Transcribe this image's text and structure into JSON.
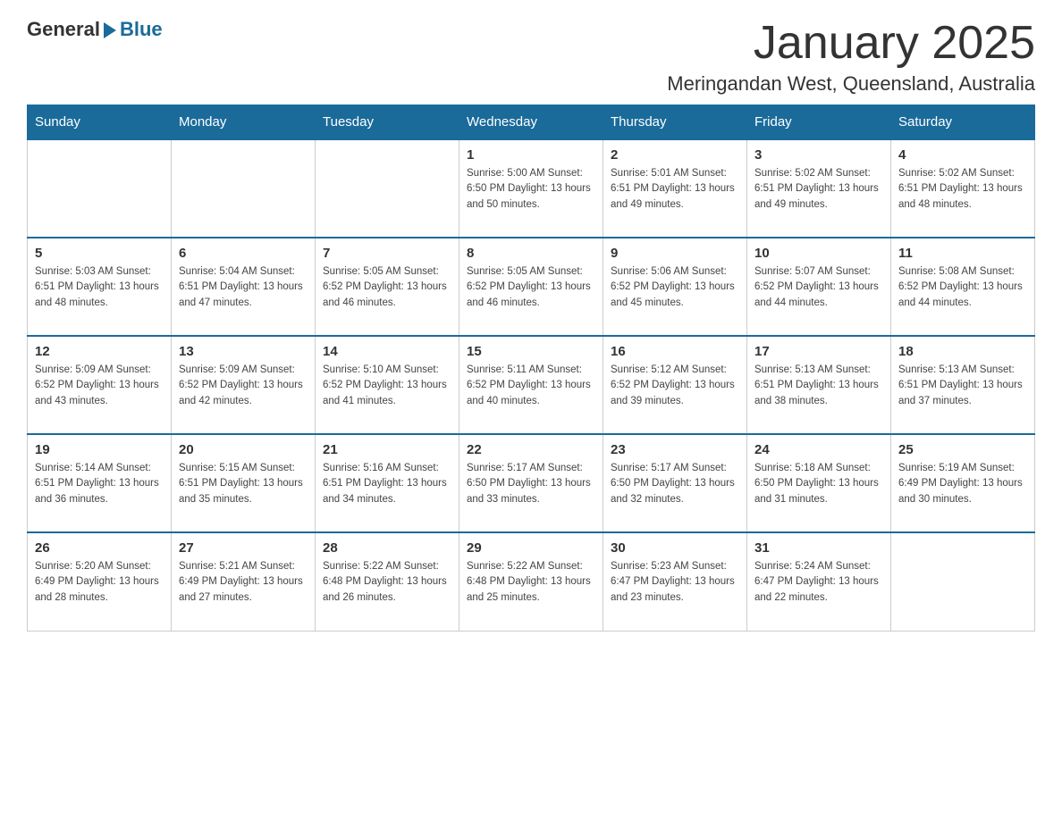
{
  "logo": {
    "general": "General",
    "blue": "Blue"
  },
  "title": "January 2025",
  "subtitle": "Meringandan West, Queensland, Australia",
  "headers": [
    "Sunday",
    "Monday",
    "Tuesday",
    "Wednesday",
    "Thursday",
    "Friday",
    "Saturday"
  ],
  "weeks": [
    [
      {
        "day": "",
        "info": ""
      },
      {
        "day": "",
        "info": ""
      },
      {
        "day": "",
        "info": ""
      },
      {
        "day": "1",
        "info": "Sunrise: 5:00 AM\nSunset: 6:50 PM\nDaylight: 13 hours\nand 50 minutes."
      },
      {
        "day": "2",
        "info": "Sunrise: 5:01 AM\nSunset: 6:51 PM\nDaylight: 13 hours\nand 49 minutes."
      },
      {
        "day": "3",
        "info": "Sunrise: 5:02 AM\nSunset: 6:51 PM\nDaylight: 13 hours\nand 49 minutes."
      },
      {
        "day": "4",
        "info": "Sunrise: 5:02 AM\nSunset: 6:51 PM\nDaylight: 13 hours\nand 48 minutes."
      }
    ],
    [
      {
        "day": "5",
        "info": "Sunrise: 5:03 AM\nSunset: 6:51 PM\nDaylight: 13 hours\nand 48 minutes."
      },
      {
        "day": "6",
        "info": "Sunrise: 5:04 AM\nSunset: 6:51 PM\nDaylight: 13 hours\nand 47 minutes."
      },
      {
        "day": "7",
        "info": "Sunrise: 5:05 AM\nSunset: 6:52 PM\nDaylight: 13 hours\nand 46 minutes."
      },
      {
        "day": "8",
        "info": "Sunrise: 5:05 AM\nSunset: 6:52 PM\nDaylight: 13 hours\nand 46 minutes."
      },
      {
        "day": "9",
        "info": "Sunrise: 5:06 AM\nSunset: 6:52 PM\nDaylight: 13 hours\nand 45 minutes."
      },
      {
        "day": "10",
        "info": "Sunrise: 5:07 AM\nSunset: 6:52 PM\nDaylight: 13 hours\nand 44 minutes."
      },
      {
        "day": "11",
        "info": "Sunrise: 5:08 AM\nSunset: 6:52 PM\nDaylight: 13 hours\nand 44 minutes."
      }
    ],
    [
      {
        "day": "12",
        "info": "Sunrise: 5:09 AM\nSunset: 6:52 PM\nDaylight: 13 hours\nand 43 minutes."
      },
      {
        "day": "13",
        "info": "Sunrise: 5:09 AM\nSunset: 6:52 PM\nDaylight: 13 hours\nand 42 minutes."
      },
      {
        "day": "14",
        "info": "Sunrise: 5:10 AM\nSunset: 6:52 PM\nDaylight: 13 hours\nand 41 minutes."
      },
      {
        "day": "15",
        "info": "Sunrise: 5:11 AM\nSunset: 6:52 PM\nDaylight: 13 hours\nand 40 minutes."
      },
      {
        "day": "16",
        "info": "Sunrise: 5:12 AM\nSunset: 6:52 PM\nDaylight: 13 hours\nand 39 minutes."
      },
      {
        "day": "17",
        "info": "Sunrise: 5:13 AM\nSunset: 6:51 PM\nDaylight: 13 hours\nand 38 minutes."
      },
      {
        "day": "18",
        "info": "Sunrise: 5:13 AM\nSunset: 6:51 PM\nDaylight: 13 hours\nand 37 minutes."
      }
    ],
    [
      {
        "day": "19",
        "info": "Sunrise: 5:14 AM\nSunset: 6:51 PM\nDaylight: 13 hours\nand 36 minutes."
      },
      {
        "day": "20",
        "info": "Sunrise: 5:15 AM\nSunset: 6:51 PM\nDaylight: 13 hours\nand 35 minutes."
      },
      {
        "day": "21",
        "info": "Sunrise: 5:16 AM\nSunset: 6:51 PM\nDaylight: 13 hours\nand 34 minutes."
      },
      {
        "day": "22",
        "info": "Sunrise: 5:17 AM\nSunset: 6:50 PM\nDaylight: 13 hours\nand 33 minutes."
      },
      {
        "day": "23",
        "info": "Sunrise: 5:17 AM\nSunset: 6:50 PM\nDaylight: 13 hours\nand 32 minutes."
      },
      {
        "day": "24",
        "info": "Sunrise: 5:18 AM\nSunset: 6:50 PM\nDaylight: 13 hours\nand 31 minutes."
      },
      {
        "day": "25",
        "info": "Sunrise: 5:19 AM\nSunset: 6:49 PM\nDaylight: 13 hours\nand 30 minutes."
      }
    ],
    [
      {
        "day": "26",
        "info": "Sunrise: 5:20 AM\nSunset: 6:49 PM\nDaylight: 13 hours\nand 28 minutes."
      },
      {
        "day": "27",
        "info": "Sunrise: 5:21 AM\nSunset: 6:49 PM\nDaylight: 13 hours\nand 27 minutes."
      },
      {
        "day": "28",
        "info": "Sunrise: 5:22 AM\nSunset: 6:48 PM\nDaylight: 13 hours\nand 26 minutes."
      },
      {
        "day": "29",
        "info": "Sunrise: 5:22 AM\nSunset: 6:48 PM\nDaylight: 13 hours\nand 25 minutes."
      },
      {
        "day": "30",
        "info": "Sunrise: 5:23 AM\nSunset: 6:47 PM\nDaylight: 13 hours\nand 23 minutes."
      },
      {
        "day": "31",
        "info": "Sunrise: 5:24 AM\nSunset: 6:47 PM\nDaylight: 13 hours\nand 22 minutes."
      },
      {
        "day": "",
        "info": ""
      }
    ]
  ]
}
